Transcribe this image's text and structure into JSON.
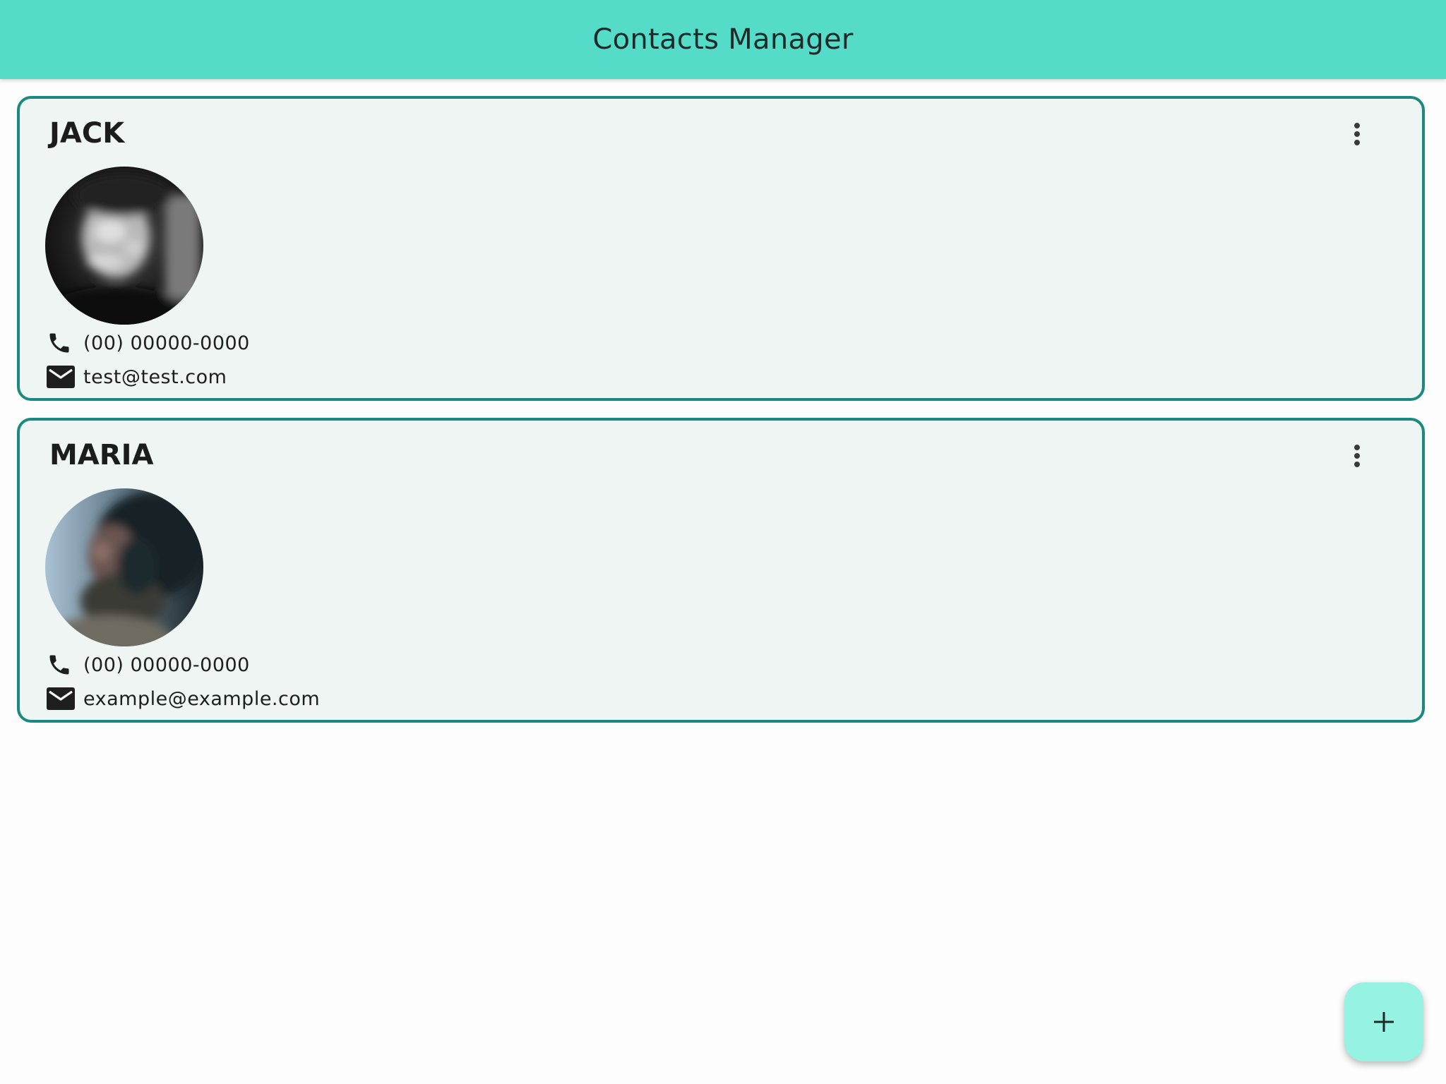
{
  "app_bar": {
    "title": "Contacts Manager"
  },
  "contacts": [
    {
      "name": "JACK",
      "phone": "(00) 00000-0000",
      "email": "test@test.com"
    },
    {
      "name": "MARIA",
      "phone": "(00) 00000-0000",
      "email": "example@example.com"
    }
  ],
  "icons": {
    "menu": "more-vert-icon",
    "phone": "phone-icon",
    "email": "mail-icon",
    "add": "plus-icon"
  },
  "colors": {
    "app_bar": "#54dcc9",
    "card_border": "#1a8a80",
    "card_background": "#eef5f3",
    "fab": "#96f2e2"
  }
}
